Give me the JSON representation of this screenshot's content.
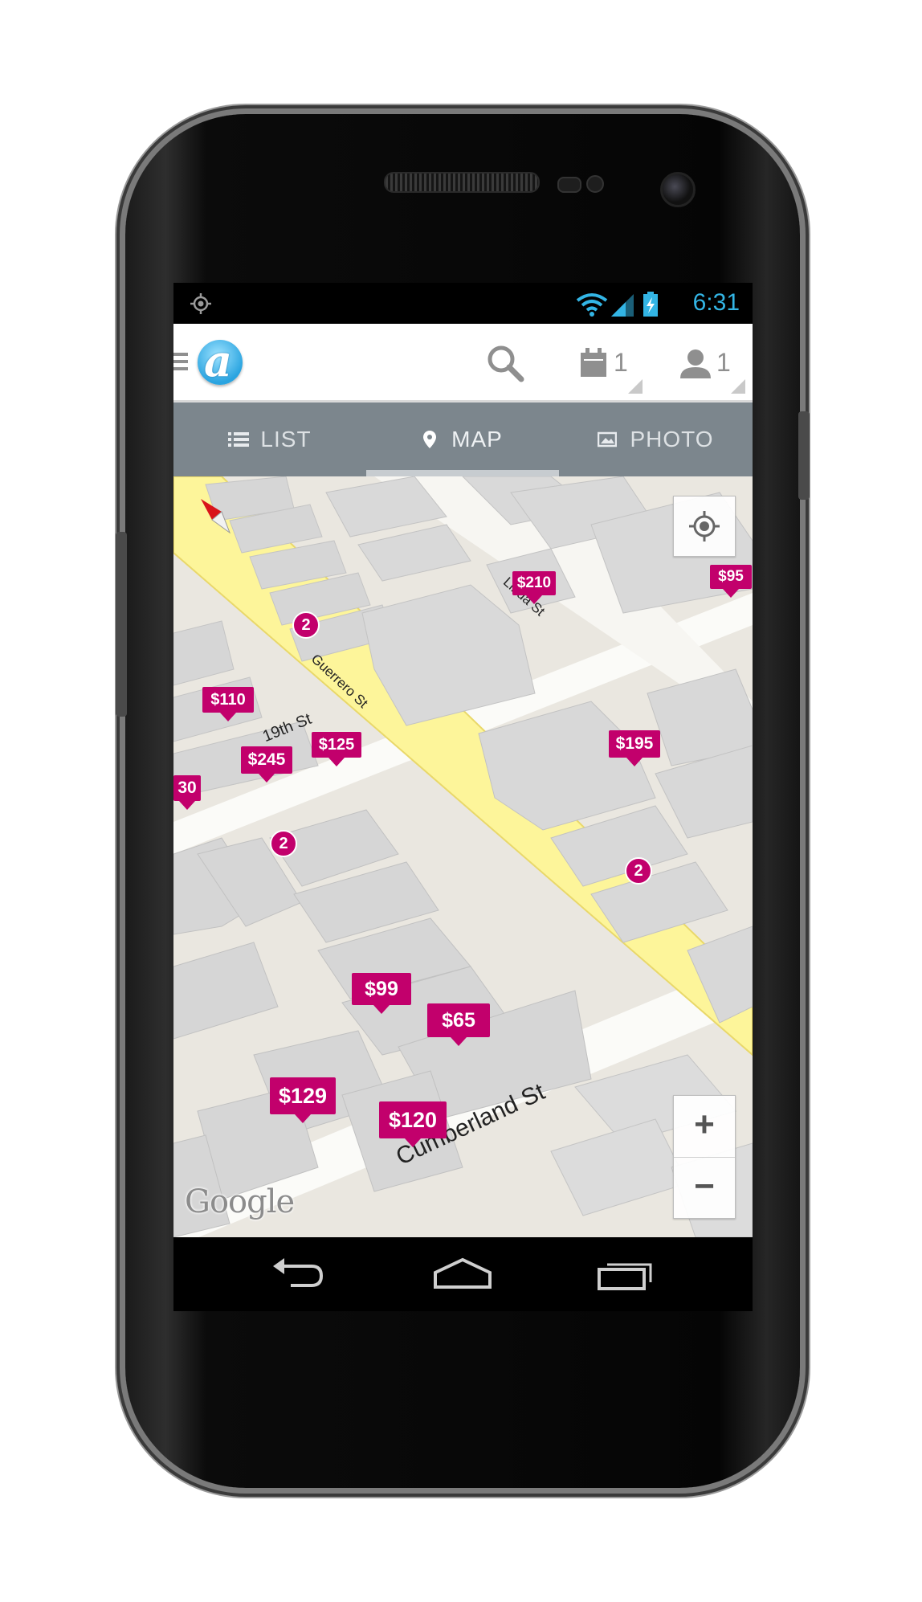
{
  "status_bar": {
    "time": "6:31",
    "icons": [
      "gps-icon",
      "wifi-icon",
      "signal-icon",
      "battery-charging-icon"
    ]
  },
  "app_bar": {
    "logo_letter": "a",
    "icons": [
      "menu-icon",
      "search-icon",
      "calendar-icon",
      "user-icon"
    ],
    "calendar_count": "1",
    "user_count": "1"
  },
  "tabs": [
    {
      "label": "LIST",
      "icon": "list-icon"
    },
    {
      "label": "MAP",
      "icon": "map-pin-icon",
      "selected": true
    },
    {
      "label": "PHOTO",
      "icon": "photo-icon"
    }
  ],
  "map": {
    "streets": {
      "guerrero": "Guerrero St",
      "linda": "Linda St",
      "nineteenth": "19th St",
      "cumberland": "Cumberland St"
    },
    "attribution": "Google",
    "price_markers": [
      "$210",
      "$95",
      "$110",
      "$125",
      "$245",
      "30",
      "$195",
      "$99",
      "$65",
      "$129",
      "$120"
    ],
    "cluster_markers": [
      "2",
      "2",
      "2"
    ],
    "controls": {
      "zoom_in": "+",
      "zoom_out": "−",
      "icons": [
        "my-location-icon",
        "compass-icon"
      ]
    },
    "colors": {
      "marker": "#c2006c",
      "major_road": "#fdf59a",
      "building": "#d8d8d8"
    }
  },
  "nav_bar": {
    "icons": [
      "back-icon",
      "home-icon",
      "recents-icon"
    ]
  },
  "colors": {
    "status_accent": "#33b5e5",
    "tab_bar": "#7c868d"
  }
}
